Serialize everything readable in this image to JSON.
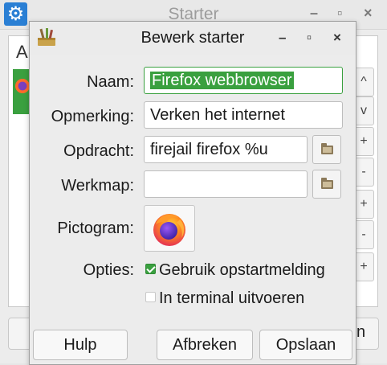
{
  "background_window": {
    "title": "Starter",
    "list_letter": "A",
    "bottom_button_fragment": "n",
    "side_button_glyphs": [
      "^",
      "v",
      "+",
      "-",
      "+",
      "-",
      "+",
      "i"
    ]
  },
  "dialog": {
    "title": "Bewerk starter",
    "controls": {
      "minimize": "–",
      "maximize": "▫",
      "close": "×"
    },
    "fields": {
      "name_label": "Naam:",
      "name_value": "Firefox webbrowser",
      "comment_label": "Opmerking:",
      "comment_value": "Verken het internet",
      "command_label": "Opdracht:",
      "command_value": "firejail firefox %u",
      "workdir_label": "Werkmap:",
      "workdir_value": "",
      "icon_label": "Pictogram:",
      "icon_name": "firefox-icon"
    },
    "options": {
      "label": "Opties:",
      "startup_notification_label": "Gebruik opstartmelding",
      "startup_notification_checked": true,
      "run_in_terminal_label": "In terminal uitvoeren",
      "run_in_terminal_checked": false
    },
    "buttons": {
      "help": "Hulp",
      "cancel": "Afbreken",
      "save": "Opslaan"
    }
  },
  "colors": {
    "accent": "#3aa03f",
    "app_icon_blue": "#2a7fd4"
  }
}
